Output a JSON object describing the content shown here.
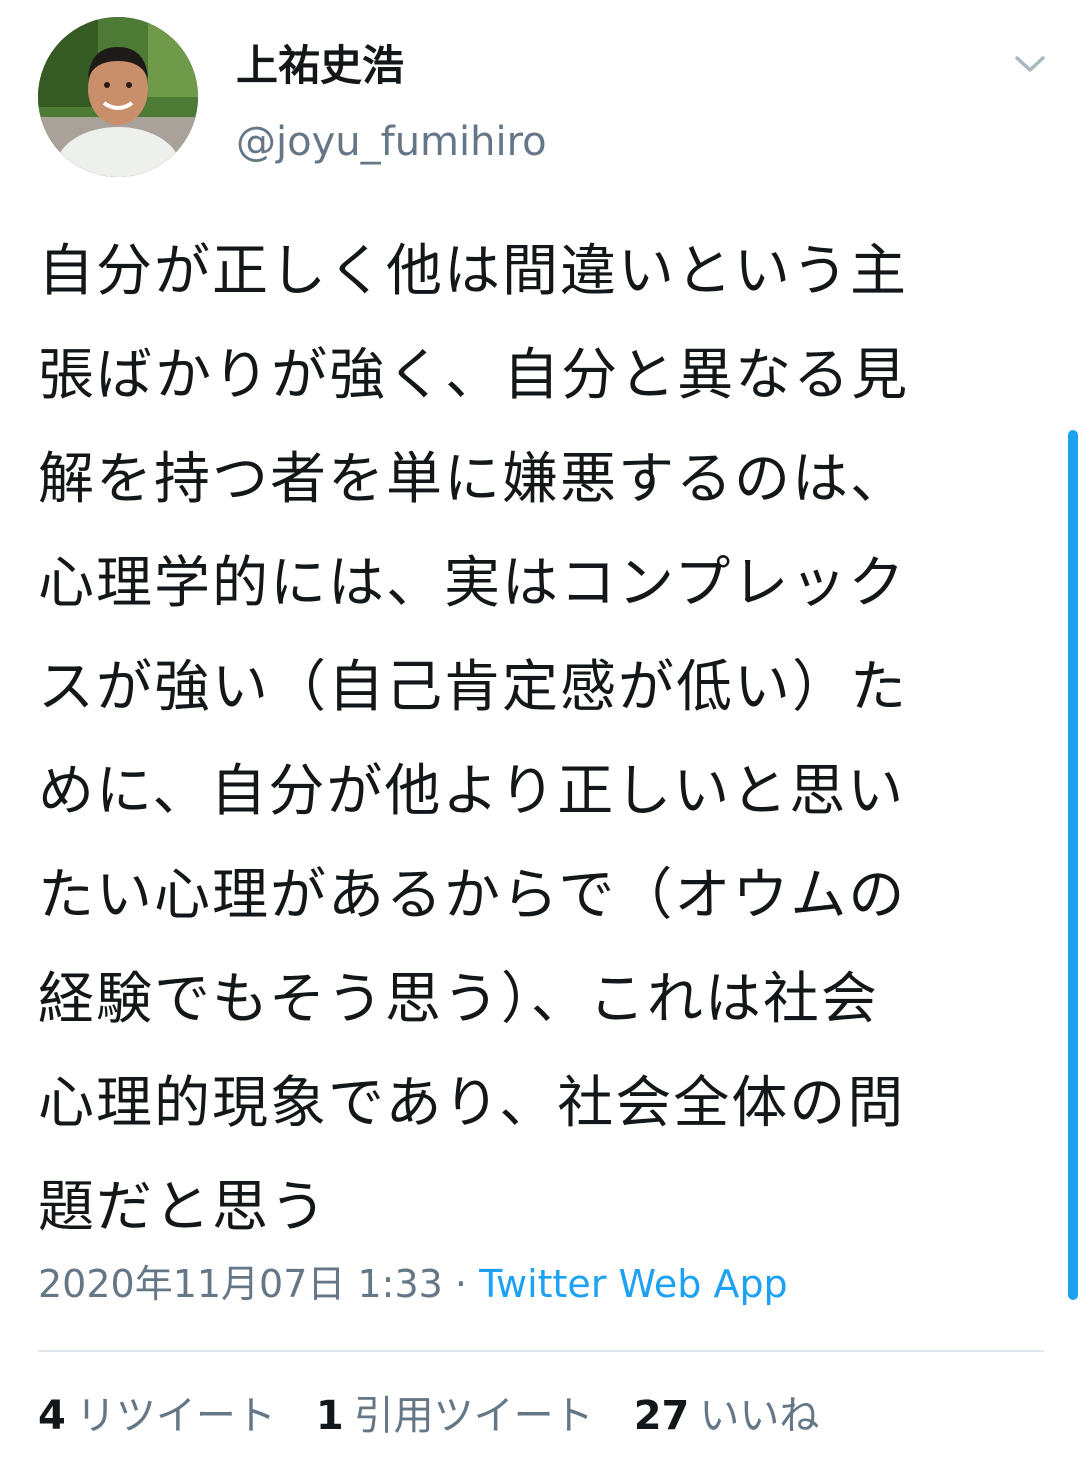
{
  "user": {
    "display_name": "上祐史浩",
    "handle": "@joyu_fumihiro"
  },
  "tweet": {
    "text": "自分が正しく他は間違いという主\n張ばかりが強く、自分と異なる見\n解を持つ者を単に嫌悪するのは、\n心理学的には、実はコンプレック\nスが強い（自己肯定感が低い）た\nめに、自分が他より正しいと思い\nたい心理があるからで（オウムの\n経験でもそう思う）、これは社会\n心理的現象であり、社会全体の問\n題だと思う",
    "timestamp": "2020年11月07日 1:33",
    "separator": " · ",
    "source": "Twitter Web App"
  },
  "stats": {
    "retweets_count": "4",
    "retweets_label": "リツイート",
    "quotes_count": "1",
    "quotes_label": "引用ツイート",
    "likes_count": "27",
    "likes_label": "いいね"
  },
  "icons": {
    "caret": "chevron-down-icon",
    "avatar": "profile-photo"
  },
  "colors": {
    "text": "#14171a",
    "secondary": "#657786",
    "accent": "#1da1f2",
    "divider": "#e1e8ed"
  }
}
